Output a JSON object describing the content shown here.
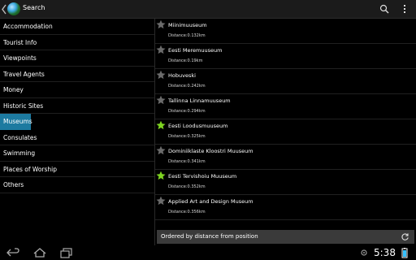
{
  "actionbar": {
    "title": "Search",
    "icons": {
      "up": "back-chevron-icon",
      "logo": "globe-icon",
      "search": "search-icon",
      "overflow": "overflow-menu-icon"
    }
  },
  "sidebar": {
    "items": [
      {
        "label": "Accommodation"
      },
      {
        "label": "Tourist Info"
      },
      {
        "label": "Viewpoints"
      },
      {
        "label": "Travel Agents"
      },
      {
        "label": "Money"
      },
      {
        "label": "Historic Sites"
      },
      {
        "label": "Museums",
        "selected": true
      },
      {
        "label": "Consulates"
      },
      {
        "label": "Swimming"
      },
      {
        "label": "Places of Worship"
      },
      {
        "label": "Others"
      }
    ],
    "selected_color": "#1d7aa0"
  },
  "list": {
    "items": [
      {
        "name": "Miinimuuseum",
        "distance": "Distance:0.132km",
        "favorite": false
      },
      {
        "name": "Eesti Meremuuseum",
        "distance": "Distance:0.19km",
        "favorite": false
      },
      {
        "name": "Hobuveski",
        "distance": "Distance:0.242km",
        "favorite": false
      },
      {
        "name": "Tallinna Linnamuuseum",
        "distance": "Distance:0.294km",
        "favorite": false
      },
      {
        "name": "Eesti Loodusmuuseum",
        "distance": "Distance:0.325km",
        "favorite": true
      },
      {
        "name": "Dominiiklaste Kloostri Muuseum",
        "distance": "Distance:0.341km",
        "favorite": false
      },
      {
        "name": "Eesti Tervishoiu Muuseum",
        "distance": "Distance:0.352km",
        "favorite": true
      },
      {
        "name": "Applied Art and Design Museum",
        "distance": "Distance:0.356km",
        "favorite": false
      }
    ],
    "star_colors": {
      "on": "#7ed321",
      "off": "#6b6b6b"
    }
  },
  "footer": {
    "status": "Ordered by distance from position",
    "refresh_icon": "refresh-icon"
  },
  "navbar": {
    "time": "5:38",
    "icons": [
      "back-icon",
      "home-icon",
      "recent-apps-icon",
      "location-icon",
      "battery-icon"
    ]
  }
}
